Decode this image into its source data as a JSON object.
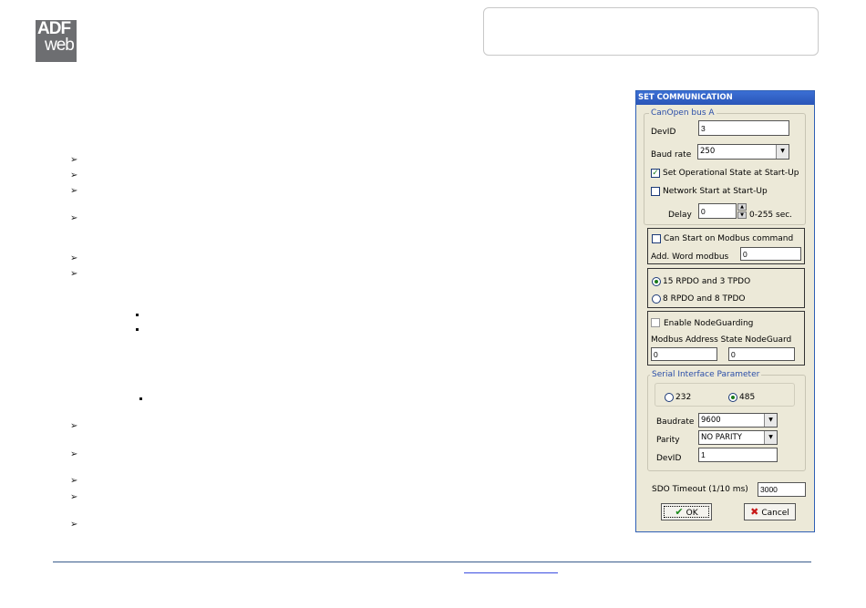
{
  "logo": {
    "line1": "ADF",
    "line2": "web"
  },
  "dialog": {
    "title": "SET COMMUNICATION",
    "canopen": {
      "legend": "CanOpen bus  A",
      "devid_label": "DevID",
      "devid_value": "3",
      "baud_label": "Baud rate",
      "baud_value": "250",
      "set_operational_label": "Set Operational State at Start-Up",
      "set_operational_checked": true,
      "network_start_label": "Network Start at Start-Up",
      "network_start_checked": false,
      "delay_label": "Delay",
      "delay_value": "0",
      "delay_unit": "0-255 sec."
    },
    "modbus_panel": {
      "can_start_label": "Can Start on Modbus command",
      "add_word_label": "Add. Word modbus",
      "add_word_value": "0"
    },
    "pdo_panel": {
      "option1": "15 RPDO and 3 TPDO",
      "option2": "8 RPDO and 8 TPDO",
      "selected": 1
    },
    "nodeguard_panel": {
      "enable_label": "Enable NodeGuarding",
      "address_label": "Modbus Address State NodeGuard",
      "value1": "0",
      "value2": "0"
    },
    "serial": {
      "legend": "Serial Interface Parameter",
      "opt232": "232",
      "opt485": "485",
      "baudrate_label": "Baudrate",
      "baudrate_value": "9600",
      "parity_label": "Parity",
      "parity_value": "NO PARITY",
      "devid_label": "DevID",
      "devid_value": "1"
    },
    "sdo_label": "SDO Timeout (1/10 ms)",
    "sdo_value": "3000",
    "ok_label": "OK",
    "cancel_label": "Cancel"
  }
}
